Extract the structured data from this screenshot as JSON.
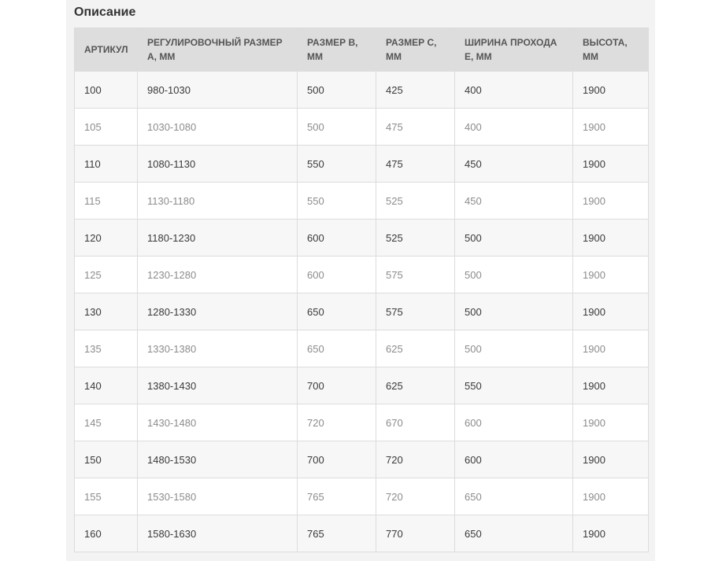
{
  "section": {
    "title": "Описание"
  },
  "table": {
    "headers": [
      "АРТИКУЛ",
      "РЕГУЛИРОВОЧНЫЙ РАЗМЕР А, ММ",
      "РАЗМЕР В, ММ",
      "РАЗМЕР С, ММ",
      "ШИРИНА ПРОХОДА Е, ММ",
      "ВЫСОТА, ММ"
    ],
    "rows": [
      [
        "100",
        "980-1030",
        "500",
        "425",
        "400",
        "1900"
      ],
      [
        "105",
        "1030-1080",
        "500",
        "475",
        "400",
        "1900"
      ],
      [
        "110",
        "1080-1130",
        "550",
        "475",
        "450",
        "1900"
      ],
      [
        "115",
        "1130-1180",
        "550",
        "525",
        "450",
        "1900"
      ],
      [
        "120",
        "1180-1230",
        "600",
        "525",
        "500",
        "1900"
      ],
      [
        "125",
        "1230-1280",
        "600",
        "575",
        "500",
        "1900"
      ],
      [
        "130",
        "1280-1330",
        "650",
        "575",
        "500",
        "1900"
      ],
      [
        "135",
        "1330-1380",
        "650",
        "625",
        "500",
        "1900"
      ],
      [
        "140",
        "1380-1430",
        "700",
        "625",
        "550",
        "1900"
      ],
      [
        "145",
        "1430-1480",
        "720",
        "670",
        "600",
        "1900"
      ],
      [
        "150",
        "1480-1530",
        "700",
        "720",
        "600",
        "1900"
      ],
      [
        "155",
        "1530-1580",
        "765",
        "720",
        "650",
        "1900"
      ],
      [
        "160",
        "1580-1630",
        "765",
        "770",
        "650",
        "1900"
      ]
    ]
  }
}
